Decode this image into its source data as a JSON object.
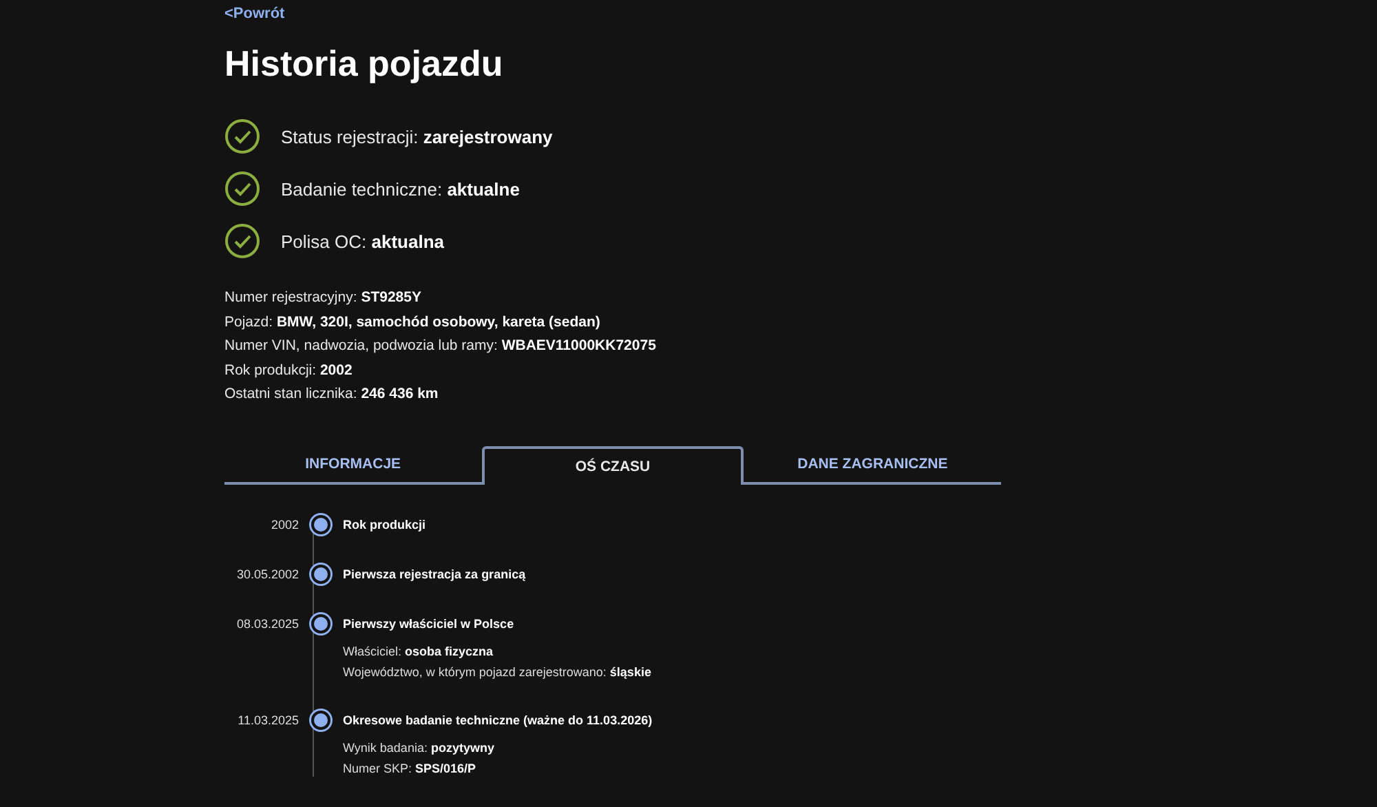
{
  "back_link": "<Powrót",
  "title": "Historia pojazdu",
  "checks": [
    {
      "label": "Status rejestracji:",
      "value": "zarejestrowany",
      "ok": true
    },
    {
      "label": "Badanie techniczne:",
      "value": "aktualne",
      "ok": true
    },
    {
      "label": "Polisa OC:",
      "value": "aktualna",
      "ok": true
    }
  ],
  "details": [
    {
      "label": "Numer rejestracyjny:",
      "value": "ST9285Y"
    },
    {
      "label": "Pojazd:",
      "value": "BMW, 320I, samochód osobowy, kareta (sedan)"
    },
    {
      "label": "Numer VIN, nadwozia, podwozia lub ramy:",
      "value": "WBAEV11000KK72075"
    },
    {
      "label": "Rok produkcji:",
      "value": "2002"
    },
    {
      "label": "Ostatni stan licznika:",
      "value": "246 436 km"
    }
  ],
  "tabs": [
    {
      "label": "INFORMACJE",
      "selected": false
    },
    {
      "label": "OŚ CZASU",
      "selected": true
    },
    {
      "label": "DANE ZAGRANICZNE",
      "selected": false
    }
  ],
  "timeline": [
    {
      "date": "2002",
      "title": "Rok produkcji"
    },
    {
      "date": "30.05.2002",
      "title": "Pierwsza rejestracja za granicą"
    },
    {
      "date": "08.03.2025",
      "title": "Pierwszy właściciel w Polsce",
      "facts": [
        {
          "label": "Właściciel:",
          "value": "osoba fizyczna"
        },
        {
          "label": "Województwo, w którym pojazd zarejestrowano:",
          "value": "śląskie"
        }
      ]
    },
    {
      "date": "11.03.2025",
      "title": "Okresowe badanie techniczne (ważne do 11.03.2026)",
      "facts": [
        {
          "label": "Wynik badania:",
          "value": "pozytywny"
        },
        {
          "label": "Numer SKP:",
          "value": "SPS/016/P"
        }
      ]
    }
  ]
}
